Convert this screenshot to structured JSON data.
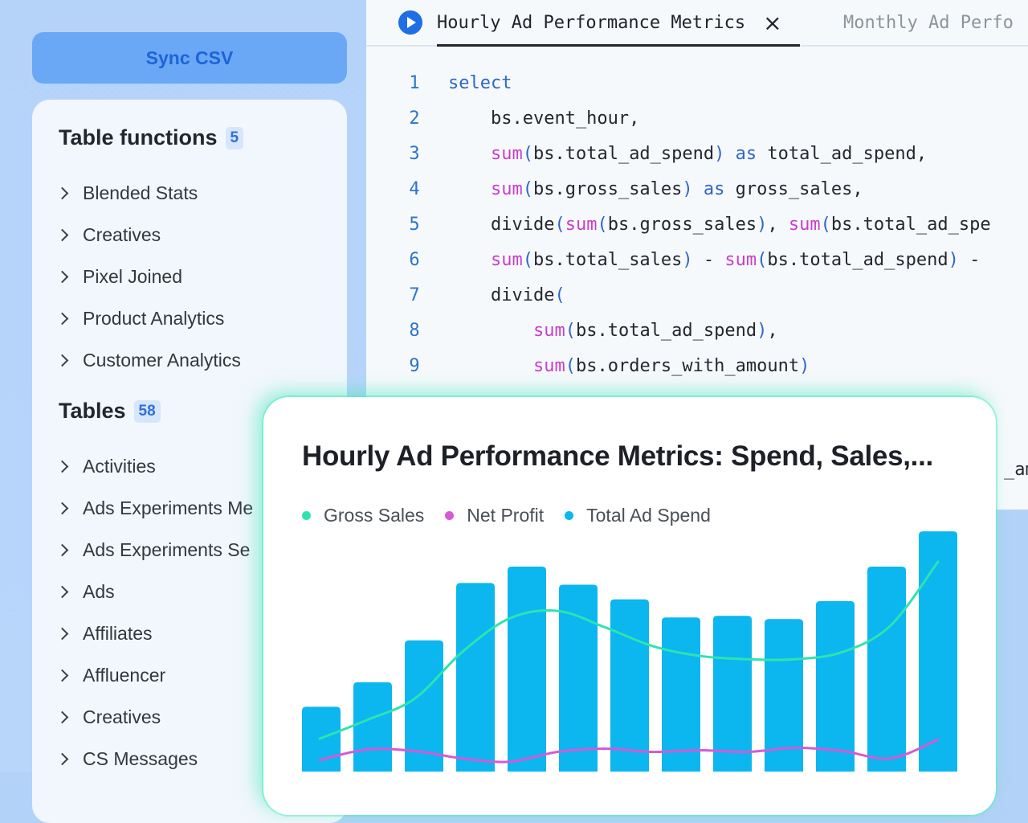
{
  "sidebar": {
    "sync_button": "Sync CSV",
    "table_functions": {
      "title": "Table functions",
      "count": "5",
      "items": [
        "Blended Stats",
        "Creatives",
        "Pixel Joined",
        "Product Analytics",
        "Customer Analytics"
      ]
    },
    "tables": {
      "title": "Tables",
      "count": "58",
      "items": [
        "Activities",
        "Ads Experiments Me",
        "Ads Experiments Se",
        "Ads",
        "Affiliates",
        "Affluencer",
        "Creatives",
        "CS Messages"
      ]
    }
  },
  "editor": {
    "tabs": [
      {
        "label": "Hourly Ad Performance Metrics",
        "active": true
      },
      {
        "label": "Monthly Ad Perfo",
        "active": false
      }
    ],
    "lines": [
      {
        "n": "1",
        "text": "select"
      },
      {
        "n": "2",
        "text": "    bs.event_hour,"
      },
      {
        "n": "3",
        "text": "    sum(bs.total_ad_spend) as total_ad_spend,"
      },
      {
        "n": "4",
        "text": "    sum(bs.gross_sales) as gross_sales,"
      },
      {
        "n": "5",
        "text": "    divide(sum(bs.gross_sales), sum(bs.total_ad_spe"
      },
      {
        "n": "6",
        "text": "    sum(bs.total_sales) - sum(bs.total_ad_spend) -"
      },
      {
        "n": "7",
        "text": "    divide("
      },
      {
        "n": "8",
        "text": "        sum(bs.total_ad_spend),"
      },
      {
        "n": "9",
        "text": "        sum(bs.orders_with_amount)"
      }
    ],
    "overflow_text": "_am"
  },
  "chart_card": {
    "title": "Hourly Ad Performance Metrics: Spend, Sales,..."
  },
  "chart_data": {
    "type": "bar",
    "series": [
      {
        "name": "Gross Sales",
        "kind": "line",
        "color": "#2ee3b0",
        "values": [
          4.0,
          6.3,
          8.9,
          14.6,
          18.7,
          19.6,
          17.6,
          15.3,
          14.1,
          13.7,
          13.7,
          14.6,
          17.8,
          25.6
        ]
      },
      {
        "name": "Net Profit",
        "kind": "line",
        "color": "#d659d6",
        "values": [
          1.4,
          2.7,
          2.5,
          1.6,
          1.2,
          2.4,
          2.8,
          2.4,
          2.6,
          2.4,
          2.9,
          2.5,
          1.6,
          3.9
        ]
      },
      {
        "name": "Total Ad Spend",
        "kind": "bar",
        "color": "#0cb6ee",
        "values": [
          7.9,
          10.9,
          16.0,
          23.0,
          25.0,
          22.8,
          21.0,
          18.8,
          19.0,
          18.6,
          20.8,
          25.0,
          29.3
        ]
      }
    ],
    "ylim": [
      0,
      30
    ],
    "grid": false,
    "legend_position": "top-left"
  },
  "colors": {
    "accent": "#1f6ee3",
    "sync_button_bg": "#6aa8f6",
    "bar": "#0cb6ee",
    "gross_sales": "#2ee3b0",
    "net_profit": "#d659d6"
  }
}
